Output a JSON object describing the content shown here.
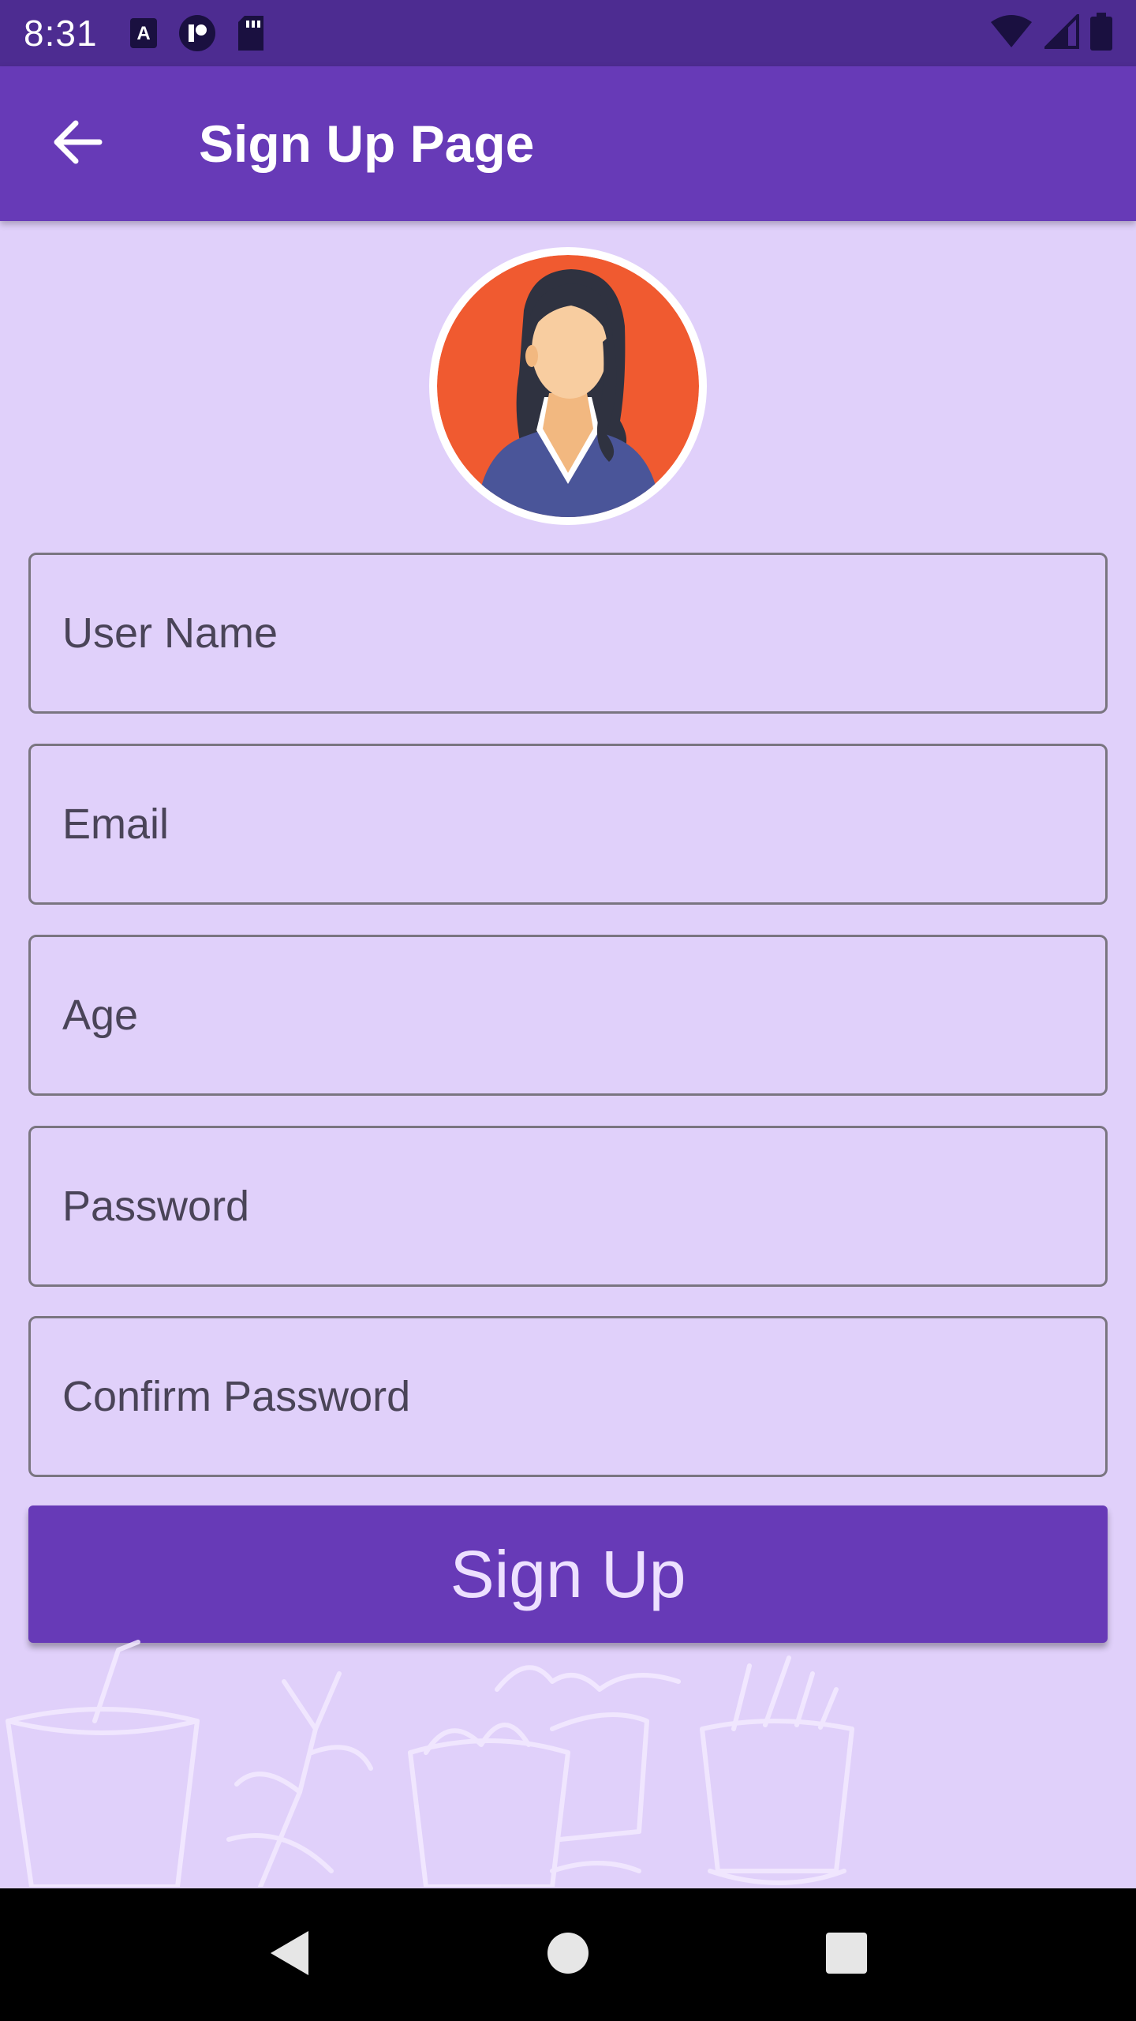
{
  "status_bar": {
    "time": "8:31",
    "icons": [
      "keyboard-a-icon",
      "app-circle-icon",
      "sd-card-icon",
      "wifi-icon",
      "signal-icon",
      "battery-icon"
    ]
  },
  "app_bar": {
    "title": "Sign Up Page",
    "back_icon": "arrow-back-icon"
  },
  "form": {
    "fields": [
      {
        "name": "username",
        "placeholder": "User Name",
        "value": ""
      },
      {
        "name": "email",
        "placeholder": "Email",
        "value": ""
      },
      {
        "name": "age",
        "placeholder": "Age",
        "value": ""
      },
      {
        "name": "password",
        "placeholder": "Password",
        "value": ""
      },
      {
        "name": "confirm_password",
        "placeholder": "Confirm Password",
        "value": ""
      }
    ],
    "submit_label": "Sign Up"
  },
  "colors": {
    "status_bar": "#4d2c91",
    "app_bar": "#673ab7",
    "background": "#e0d0fa",
    "button": "#673ab7",
    "avatar_bg": "#f05a30"
  },
  "nav_bar": {
    "icons": [
      "back-triangle-icon",
      "home-circle-icon",
      "recents-square-icon"
    ]
  }
}
